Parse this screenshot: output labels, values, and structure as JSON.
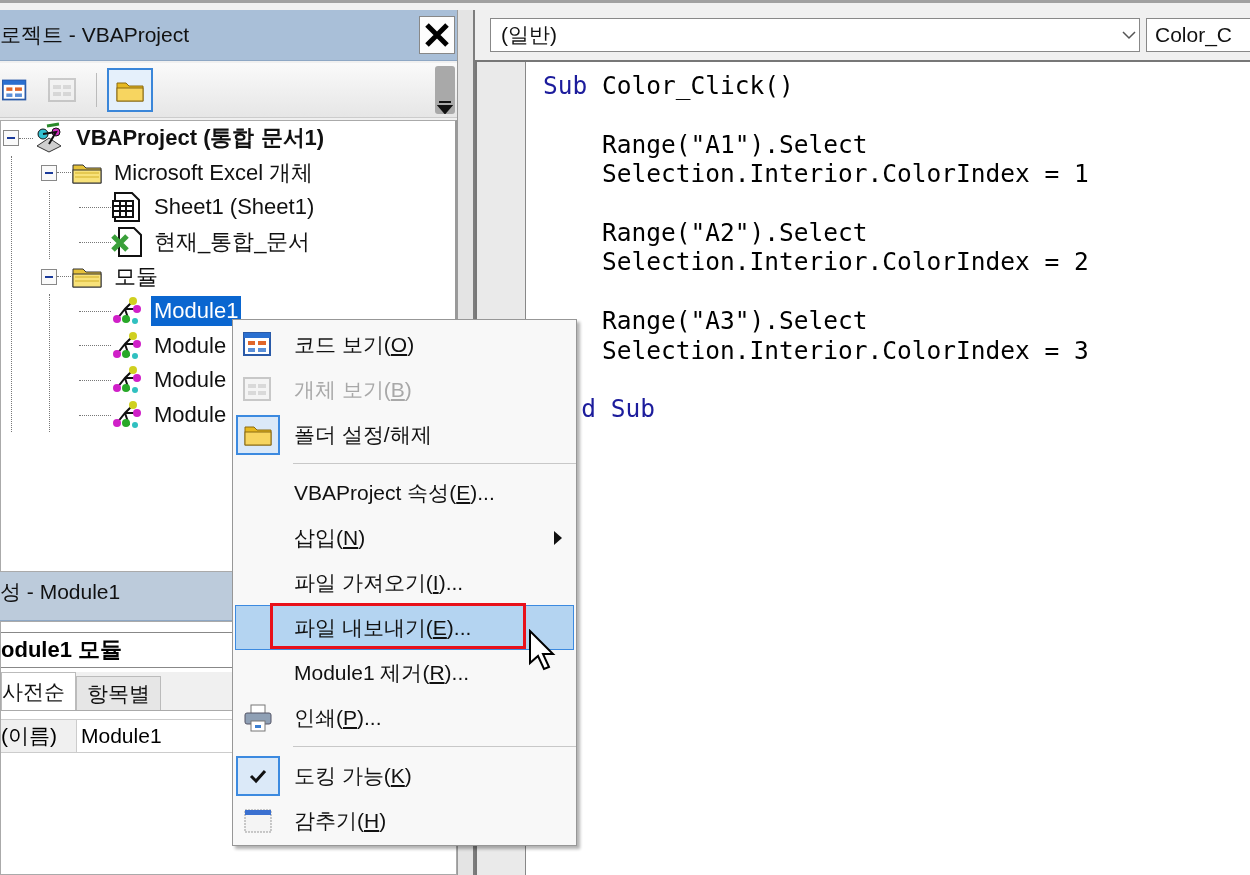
{
  "project_explorer": {
    "title": "로젝트 - VBAProject",
    "toolbar": [
      {
        "disabled": false,
        "on": false
      },
      {
        "disabled": true,
        "on": false
      },
      {
        "disabled": false,
        "on": true
      }
    ],
    "tree": [
      {
        "kind": "project",
        "label": "VBAProject (통합 문서1)",
        "expanded": true,
        "selected": false,
        "children": [
          {
            "kind": "folder",
            "label": "Microsoft Excel 개체",
            "expanded": true,
            "selected": false,
            "children": [
              {
                "kind": "sheet",
                "label": "Sheet1 (Sheet1)",
                "selected": false
              },
              {
                "kind": "workbook",
                "label": "현재_통합_문서",
                "selected": false
              }
            ]
          },
          {
            "kind": "folder",
            "label": "모듈",
            "expanded": true,
            "selected": false,
            "children": [
              {
                "kind": "module",
                "label": "Module1",
                "selected": true
              },
              {
                "kind": "module",
                "label": "Module",
                "selected": false
              },
              {
                "kind": "module",
                "label": "Module",
                "selected": false
              },
              {
                "kind": "module",
                "label": "Module",
                "selected": false
              }
            ]
          }
        ]
      }
    ]
  },
  "properties": {
    "title": "성 - Module1",
    "object": "odule1 모듈",
    "tabs": [
      {
        "label": "사전순",
        "selected": true
      },
      {
        "label": "항목별",
        "selected": false
      }
    ],
    "rows": [
      {
        "name": "(이름)",
        "value": "Module1"
      }
    ]
  },
  "code_window": {
    "object_combo": "(일반)",
    "procedure_combo": "Color_C",
    "lines": [
      {
        "kind": "top",
        "tokens": [
          {
            "text": "Sub",
            "keyword": true
          },
          {
            "text": " Color_Click()",
            "keyword": false
          }
        ]
      },
      {
        "kind": "blank"
      },
      {
        "kind": "body",
        "tokens": [
          {
            "text": "Range(\"A1\").Select",
            "keyword": false
          }
        ]
      },
      {
        "kind": "body",
        "tokens": [
          {
            "text": "Selection.Interior.ColorIndex = 1",
            "keyword": false
          }
        ]
      },
      {
        "kind": "blank"
      },
      {
        "kind": "body",
        "tokens": [
          {
            "text": "Range(\"A2\").Select",
            "keyword": false
          }
        ]
      },
      {
        "kind": "body",
        "tokens": [
          {
            "text": "Selection.Interior.ColorIndex = 2",
            "keyword": false
          }
        ]
      },
      {
        "kind": "blank"
      },
      {
        "kind": "body",
        "tokens": [
          {
            "text": "Range(\"A3\").Select",
            "keyword": false
          }
        ]
      },
      {
        "kind": "body",
        "tokens": [
          {
            "text": "Selection.Interior.ColorIndex = 3",
            "keyword": false
          }
        ]
      },
      {
        "kind": "blank"
      },
      {
        "kind": "cut",
        "tokens": [
          {
            "text": "d Sub",
            "keyword": true
          }
        ]
      }
    ]
  },
  "context_menu": [
    {
      "kind": "item",
      "before": "코드 보기(",
      "key": "O",
      "after": ")",
      "disabled": false,
      "checked": false,
      "selected": false,
      "annotated": false
    },
    {
      "kind": "item",
      "before": "개체 보기(",
      "key": "B",
      "after": ")",
      "disabled": true,
      "checked": false,
      "selected": false,
      "annotated": false
    },
    {
      "kind": "item",
      "before": "폴더 설정/해제",
      "disabled": false,
      "checked": true,
      "selected": false,
      "annotated": false
    },
    {
      "kind": "separator"
    },
    {
      "kind": "item",
      "before": "VBAProject 속성(",
      "key": "E",
      "after": ")...",
      "disabled": false,
      "checked": false,
      "selected": false,
      "annotated": false
    },
    {
      "kind": "submenu",
      "before": "삽입(",
      "key": "N",
      "after": ")",
      "disabled": false,
      "checked": false,
      "selected": false,
      "annotated": false
    },
    {
      "kind": "item",
      "before": "파일 가져오기(",
      "key": "I",
      "after": ")...",
      "disabled": false,
      "checked": false,
      "selected": false,
      "annotated": false
    },
    {
      "kind": "item",
      "before": "파일 내보내기(",
      "key": "E",
      "after": ")...",
      "disabled": false,
      "checked": false,
      "selected": true,
      "annotated": true
    },
    {
      "kind": "item",
      "before": "Module1 제거(",
      "key": "R",
      "after": ")...",
      "disabled": false,
      "checked": false,
      "selected": false,
      "annotated": false
    },
    {
      "kind": "item",
      "before": "인쇄(",
      "key": "P",
      "after": ")...",
      "disabled": false,
      "checked": false,
      "selected": false,
      "annotated": false
    },
    {
      "kind": "separator"
    },
    {
      "kind": "item",
      "before": "도킹 가능(",
      "key": "K",
      "after": ")",
      "disabled": false,
      "checked": true,
      "selected": false,
      "annotated": false
    },
    {
      "kind": "item",
      "before": "감추기(",
      "key": "H",
      "after": ")",
      "disabled": false,
      "checked": false,
      "selected": false,
      "annotated": false
    }
  ]
}
